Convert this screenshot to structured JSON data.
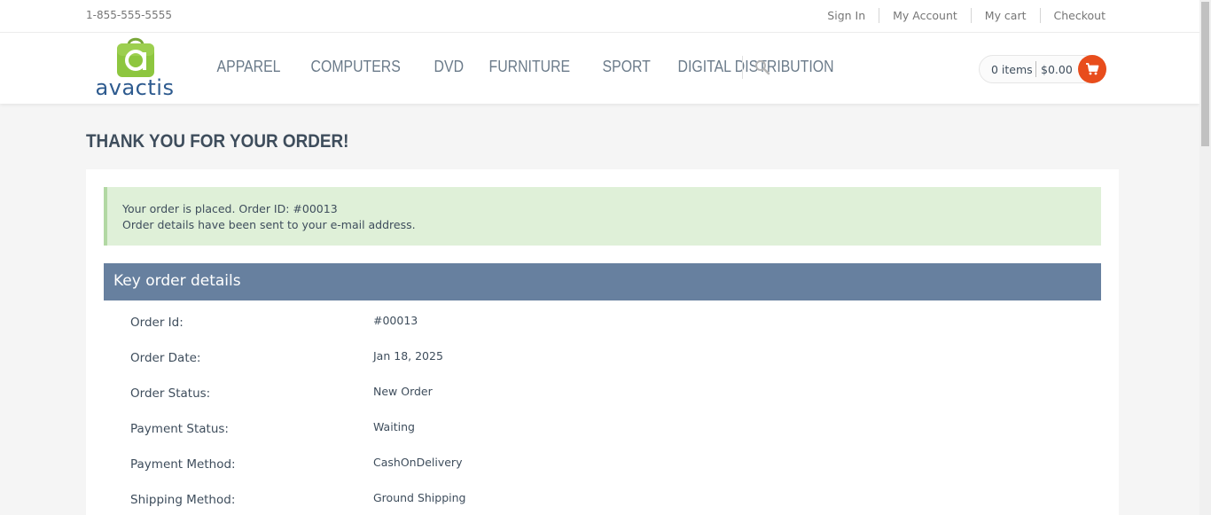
{
  "topbar": {
    "phone": "1-855-555-5555",
    "links": [
      "Sign In",
      "My Account",
      "My cart",
      "Checkout"
    ]
  },
  "header": {
    "logo_text": "avactis",
    "nav": [
      "APPAREL",
      "COMPUTERS",
      "DVD",
      "FURNITURE",
      "SPORT",
      "DIGITAL DISTRIBUTION"
    ],
    "cart": {
      "items": "0 items",
      "total": "$0.00"
    }
  },
  "main": {
    "title": "THANK YOU FOR YOUR ORDER!",
    "alert": {
      "line1": "Your order is placed. Order ID: #00013",
      "line2": "Order details have been sent to your e-mail address."
    },
    "section_title": "Key order details",
    "details": [
      {
        "label": "Order Id:",
        "value": "#00013"
      },
      {
        "label": "Order Date:",
        "value": "Jan 18, 2025"
      },
      {
        "label": "Order Status:",
        "value": "New Order"
      },
      {
        "label": "Payment Status:",
        "value": "Waiting"
      },
      {
        "label": "Payment Method:",
        "value": "CashOnDelivery"
      },
      {
        "label": "Shipping Method:",
        "value": "Ground Shipping"
      }
    ]
  },
  "colors": {
    "accent": "#e84d1c",
    "section_header": "#67809f",
    "alert_bg": "#dff0d8",
    "logo_green": "#8dc63f",
    "logo_blue": "#2e5b8f"
  }
}
